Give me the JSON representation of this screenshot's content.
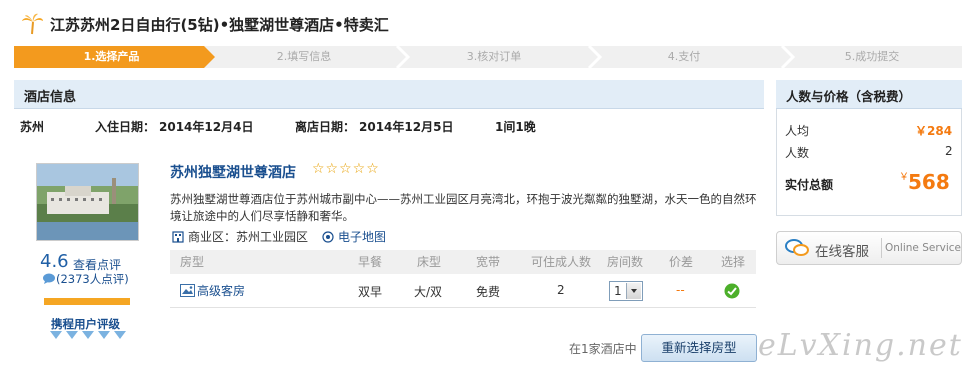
{
  "header": {
    "title": "江苏苏州2日自由行(5钻)•独墅湖世尊酒店•特卖汇"
  },
  "steps": [
    {
      "label": "1.选择产品",
      "active": true
    },
    {
      "label": "2.填写信息",
      "active": false
    },
    {
      "label": "3.核对订单",
      "active": false
    },
    {
      "label": "4.支付",
      "active": false
    },
    {
      "label": "5.成功提交",
      "active": false
    }
  ],
  "hotel_section": {
    "heading": "酒店信息",
    "city": "苏州",
    "checkin_label": "入住日期：",
    "checkin_date": "2014年12月4日",
    "checkout_label": "离店日期：",
    "checkout_date": "2014年12月5日",
    "rooms_nights": "1间1晚"
  },
  "hotel": {
    "name": "苏州独墅湖世尊酒店",
    "stars": "☆☆☆☆☆",
    "description": "苏州独墅湖世尊酒店位于苏州城市副中心——苏州工业园区月亮湾北，环抱于波光粼粼的独墅湖，水天一色的自然环境让旅途中的人们尽享恬静和奢华。",
    "district_label": "商业区：",
    "district": "苏州工业园区",
    "map_link": "电子地图",
    "score": "4.6",
    "review_link": "查看点评",
    "review_count": "(2373人点评)",
    "rating_label": "携程用户评级"
  },
  "room_table": {
    "headers": [
      "房型",
      "早餐",
      "床型",
      "宽带",
      "可住成人数",
      "房间数",
      "价差",
      "选择"
    ],
    "rows": [
      {
        "room_type": "高级客房",
        "breakfast": "双早",
        "bed": "大/双",
        "broadband": "免费",
        "adults": "2",
        "rooms": "1",
        "price_diff": "--"
      }
    ]
  },
  "footer": {
    "in_hotels": "在1家酒店中",
    "reselect_button": "重新选择房型",
    "watermark": "eLvXing.net"
  },
  "price_panel": {
    "heading": "人数与价格（含税费）",
    "per_person_label": "人均",
    "per_person_currency": "￥",
    "per_person_value": "284",
    "people_label": "人数",
    "people_value": "2",
    "total_label": "实付总额",
    "total_currency": "￥",
    "total_value": "568"
  },
  "service": {
    "label": "在线客服",
    "sub": "Online Service"
  },
  "colors": {
    "accent_orange": "#f39a1e",
    "link_blue": "#1a4f8f",
    "price_orange": "#f47a10",
    "head_bg": "#e2edf7",
    "green": "#4caf2a"
  }
}
